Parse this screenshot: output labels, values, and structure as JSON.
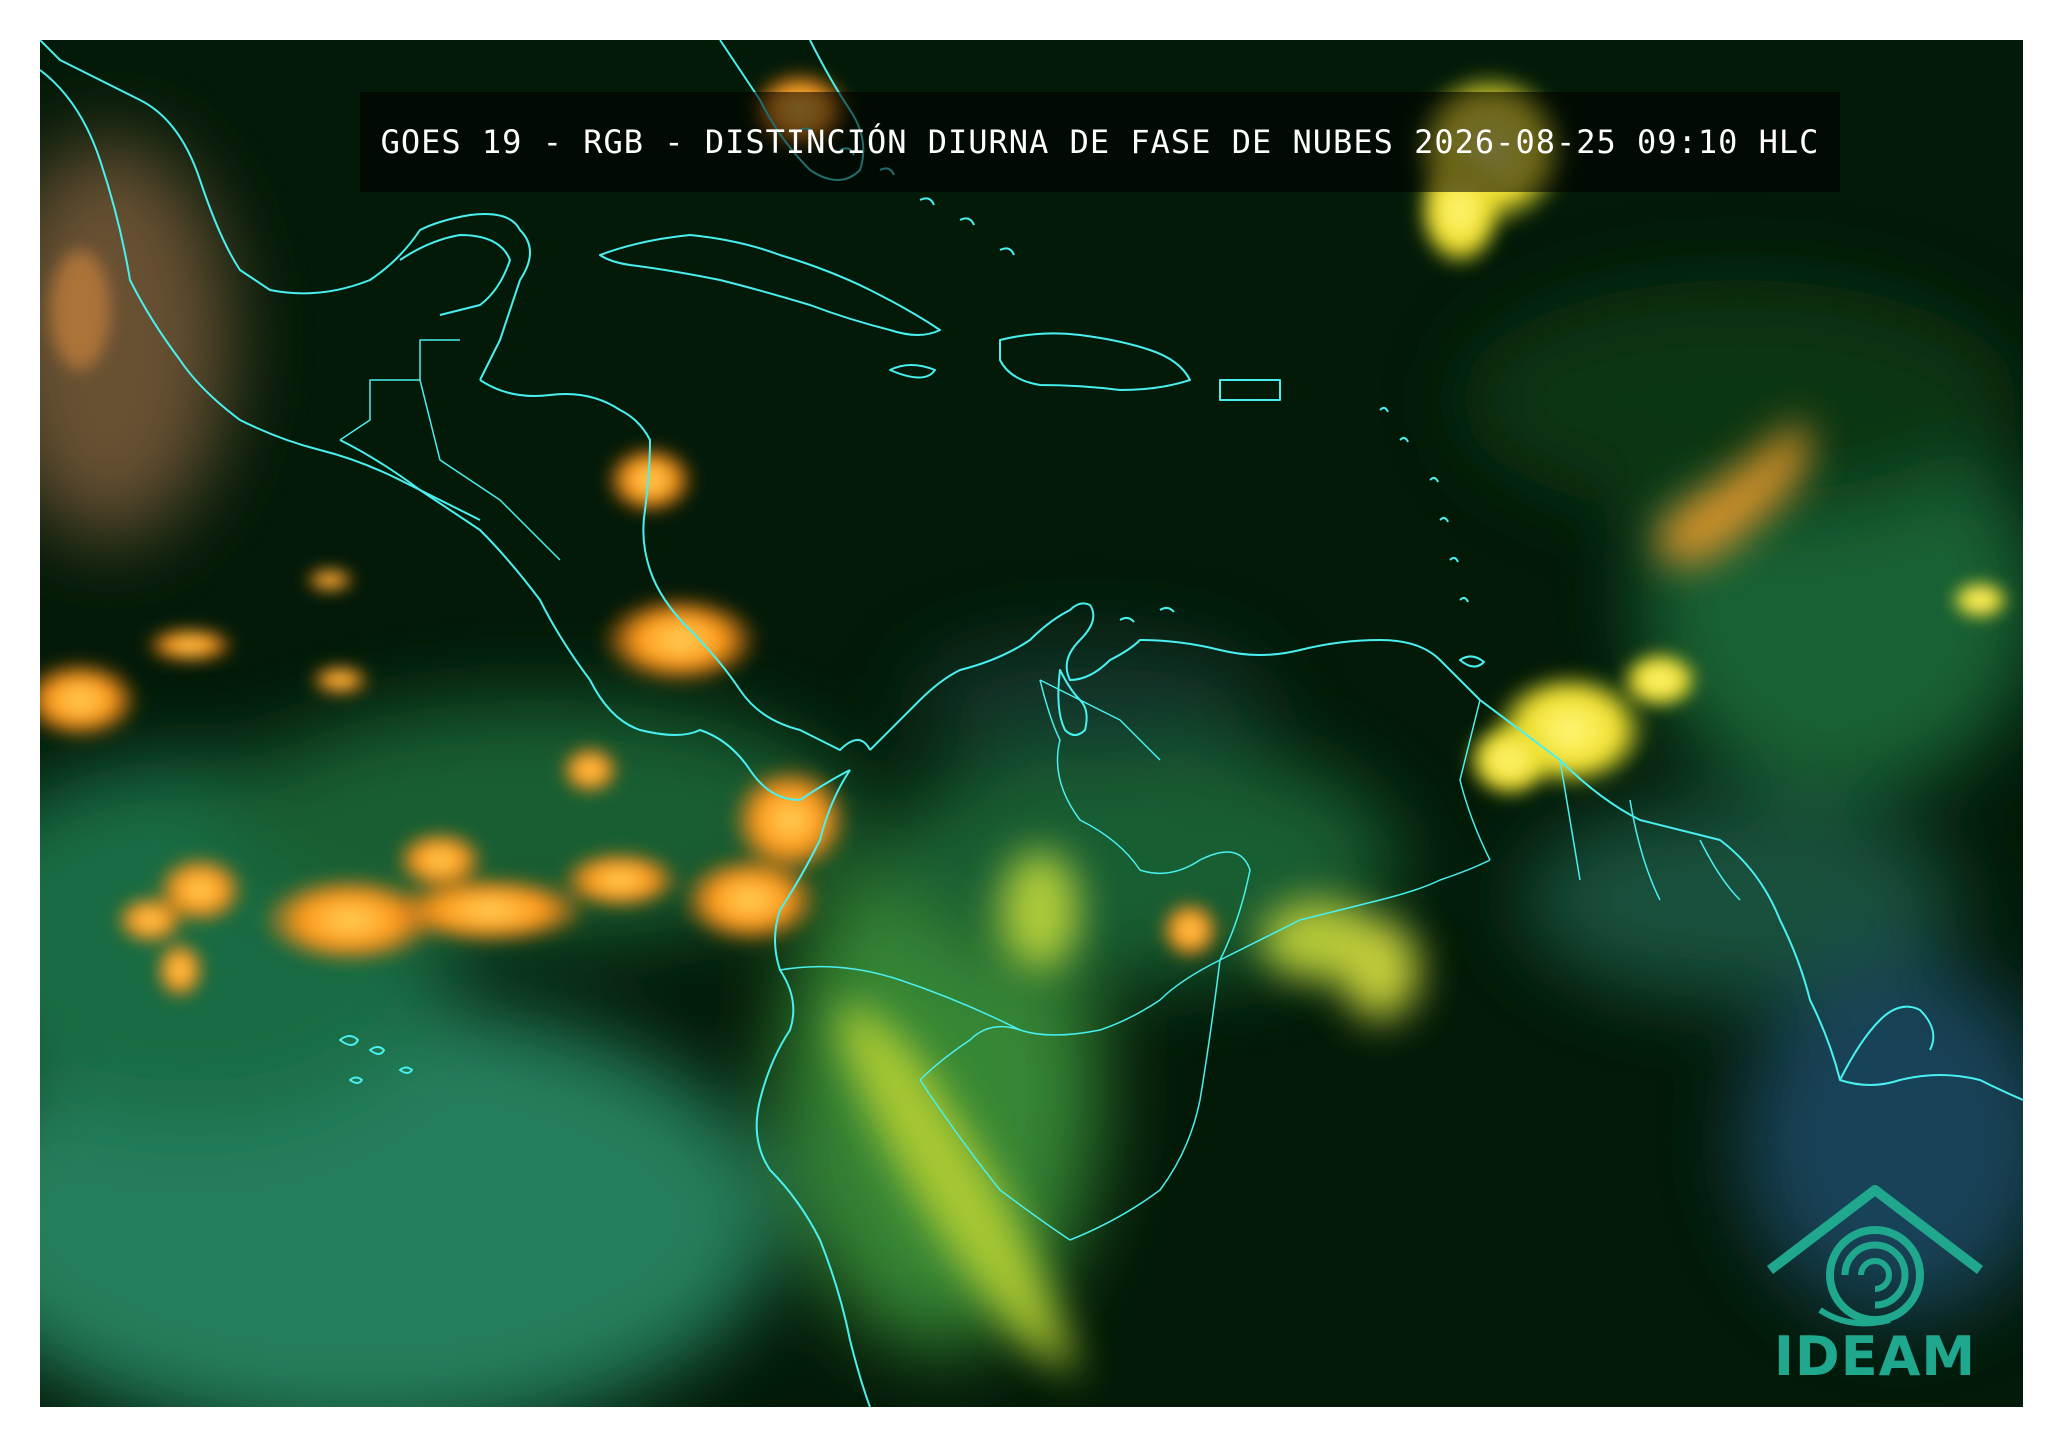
{
  "title": "GOES 19 - RGB - DISTINCIÓN DIURNA DE FASE DE NUBES 2026-08-25 09:10 HLC",
  "logo": {
    "text": "IDEAM",
    "icon": "ideam-logo-icon",
    "color": "#1fa88e"
  },
  "map": {
    "coastline_color": "#4af0f0",
    "cloud_colors": {
      "ice": "#ff9a1a",
      "mixed": "#ffe838",
      "water": "#2fbf6a",
      "background": "#031a08"
    }
  }
}
